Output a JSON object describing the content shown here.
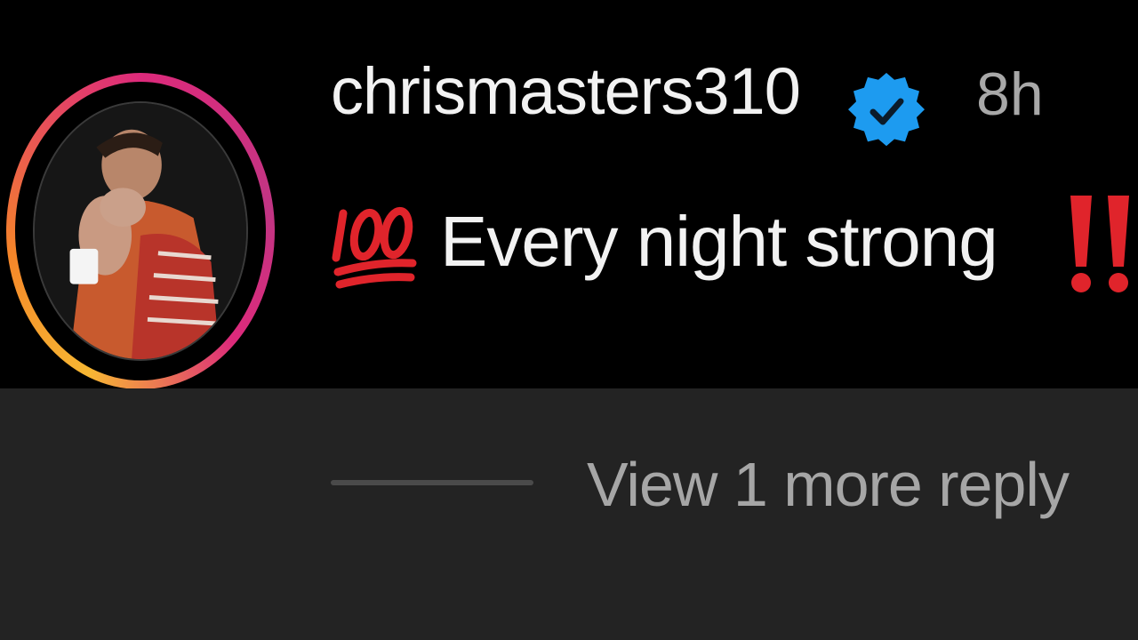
{
  "comment": {
    "username": "chrismasters310",
    "verified": true,
    "time": "8h",
    "text": "Every night strong",
    "leading_emoji": "hundred-points-icon",
    "trailing_emoji": "double-exclamation-icon"
  },
  "replies": {
    "view_more_label": "View 1 more reply"
  },
  "colors": {
    "top_background": "#000000",
    "bottom_background": "#232323",
    "username": "#f2f2f2",
    "time": "#a8a8a8",
    "verified_badge": "#1d9bf0",
    "emoji_red": "#e0242b",
    "view_more": "#a6a6a6"
  },
  "icons": {
    "avatar": "avatar",
    "verified": "verified-badge-icon",
    "story_ring": "story-ring"
  }
}
